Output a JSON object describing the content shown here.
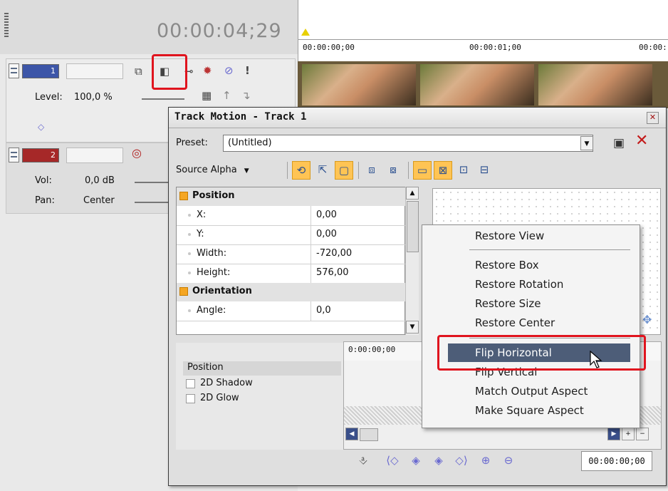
{
  "header": {
    "timecode": "00:00:04;29"
  },
  "track1": {
    "number": "1",
    "level_label": "Level:",
    "level_value": "100,0 %"
  },
  "track2": {
    "number": "2",
    "vol_label": "Vol:",
    "vol_value": "0,0 dB",
    "pan_label": "Pan:",
    "pan_value": "Center"
  },
  "timeline": {
    "ruler": [
      "00:00:00;00",
      "00:00:01;00",
      "00:00:"
    ]
  },
  "dialog": {
    "title": "Track Motion - Track 1",
    "close": "✕",
    "preset_label": "Preset:",
    "preset_value": "(Untitled)",
    "source_alpha": "Source Alpha",
    "groups": [
      {
        "name": "Position",
        "rows": [
          {
            "key": "X:",
            "value": "0,00"
          },
          {
            "key": "Y:",
            "value": "0,00"
          },
          {
            "key": "Width:",
            "value": "-720,00"
          },
          {
            "key": "Height:",
            "value": "576,00"
          }
        ]
      },
      {
        "name": "Orientation",
        "rows": [
          {
            "key": "Angle:",
            "value": "0,0"
          }
        ]
      }
    ],
    "keyframe_time": "0:00:00;00",
    "tracks": [
      {
        "label": "Position"
      },
      {
        "label": "2D Shadow"
      },
      {
        "label": "2D Glow"
      }
    ],
    "cursor_timecode": "00:00:00;00"
  },
  "context_menu": {
    "items": [
      "Restore View",
      "Restore Box",
      "Restore Rotation",
      "Restore Size",
      "Restore Center",
      "Flip Horizontal",
      "Flip Vertical",
      "Match Output Aspect",
      "Make Square Aspect"
    ],
    "selected": "Flip Horizontal"
  },
  "colors": {
    "highlight_red": "#e0141e",
    "menu_selected": "#4d5d78",
    "toolbar_active": "#ffc454",
    "track1": "#3d56a8",
    "track2": "#a62828"
  },
  "icons": [
    "track-motion-icon",
    "composite-icon",
    "gear-icon",
    "no-entry-icon",
    "exclamation-icon",
    "save-icon",
    "close-icon",
    "record-icon",
    "move-cross-icon",
    "mouse-pointer-icon"
  ]
}
